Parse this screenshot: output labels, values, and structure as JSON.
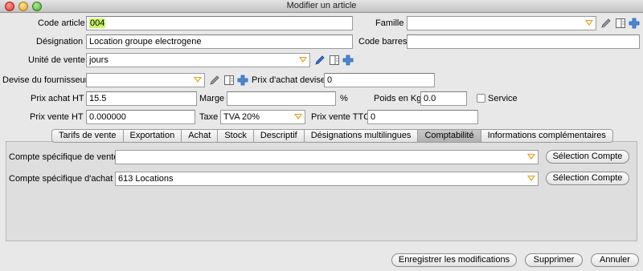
{
  "window": {
    "title": "Modifier un article"
  },
  "form": {
    "code_article": {
      "label": "Code article",
      "value": "004"
    },
    "famille": {
      "label": "Famille",
      "value": ""
    },
    "designation": {
      "label": "Désignation",
      "value": "Location groupe electrogene"
    },
    "code_barres": {
      "label": "Code barres",
      "value": ""
    },
    "unite_vente": {
      "label": "Unité de vente",
      "value": "jours"
    },
    "devise_fournisseur": {
      "label": "Devise du fournisseur",
      "value": ""
    },
    "prix_achat_devise": {
      "label": "Prix d'achat devise",
      "value": "0"
    },
    "prix_achat_ht": {
      "label": "Prix achat HT",
      "value": "15.5"
    },
    "marge": {
      "label": "Marge",
      "value": "",
      "unit": "%"
    },
    "poids": {
      "label": "Poids en Kg",
      "value": "0.0"
    },
    "service": {
      "label": "Service",
      "checked": false
    },
    "prix_vente_ht": {
      "label": "Prix vente HT",
      "value": "0.000000"
    },
    "taxe": {
      "label": "Taxe",
      "value": "TVA 20%"
    },
    "prix_vente_ttc": {
      "label": "Prix vente TTC",
      "value": "0"
    }
  },
  "tabs": [
    {
      "label": "Tarifs de vente",
      "active": false
    },
    {
      "label": "Exportation",
      "active": false
    },
    {
      "label": "Achat",
      "active": false
    },
    {
      "label": "Stock",
      "active": false
    },
    {
      "label": "Descriptif",
      "active": false
    },
    {
      "label": "Désignations multilingues",
      "active": false
    },
    {
      "label": "Comptabilité",
      "active": true
    },
    {
      "label": "Informations complémentaires",
      "active": false
    }
  ],
  "panel": {
    "compte_vente": {
      "label": "Compte spécifique de vente",
      "value": "",
      "button": "Sélection Compte"
    },
    "compte_achat": {
      "label": "Compte spécifique d'achat",
      "value": "613 Locations",
      "button": "Sélection Compte"
    }
  },
  "footer": {
    "save": "Enregistrer les modifications",
    "delete": "Supprimer",
    "cancel": "Annuler"
  },
  "icons": {
    "edit": "pencil-icon",
    "detail": "detail-icon",
    "add": "plus-icon"
  },
  "colors": {
    "highlight": "#c6f86a",
    "combo_caret": "#e0a020",
    "add_icon": "#4a88d8"
  }
}
